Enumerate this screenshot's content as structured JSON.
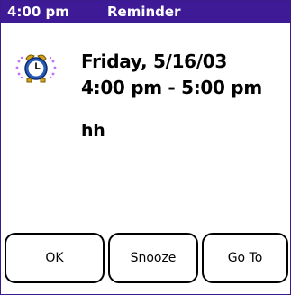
{
  "header": {
    "time": "4:00 pm",
    "title": "Reminder"
  },
  "event": {
    "date": "Friday, 5/16/03",
    "time_range": "4:00 pm - 5:00 pm",
    "note": "hh",
    "icon": "alarm-clock-icon"
  },
  "buttons": {
    "ok": "OK",
    "snooze": "Snooze",
    "goto": "Go To"
  },
  "colors": {
    "titlebar": "#3e1a96",
    "clock_face": "#2a5ab8",
    "clock_bell": "#d4a017",
    "clock_ring_waves": "#c070ff"
  }
}
